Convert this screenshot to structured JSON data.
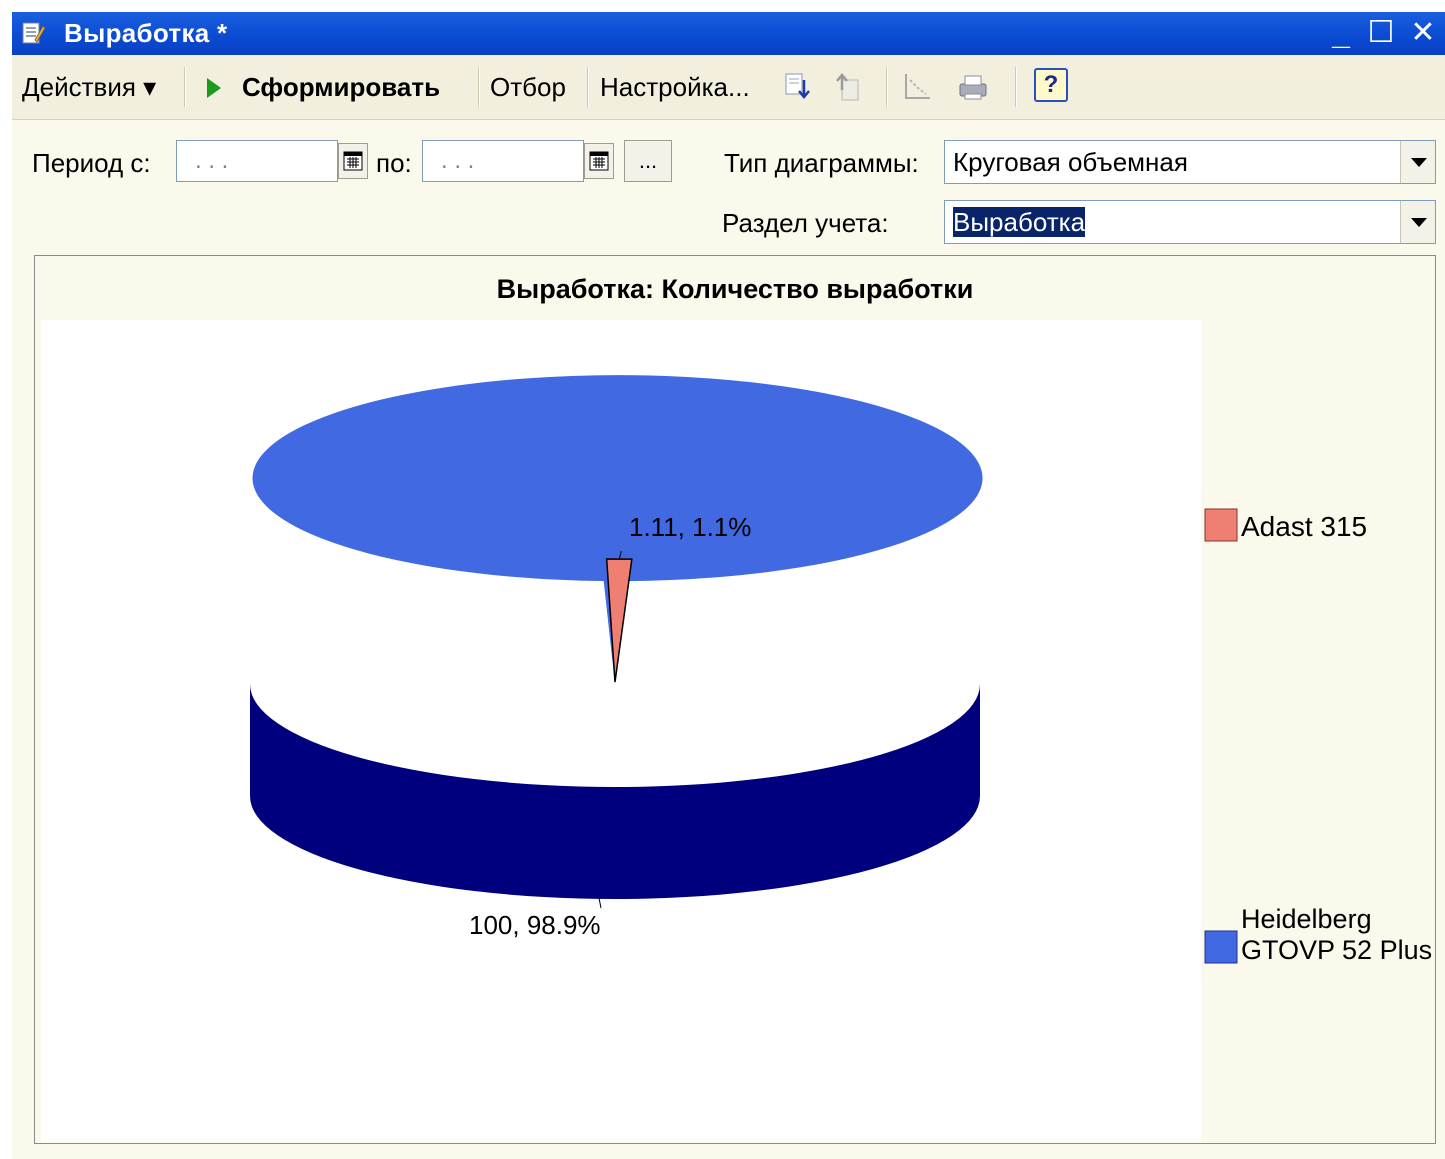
{
  "window": {
    "title": "Выработка *",
    "controls": [
      "_",
      "☐",
      "✕"
    ]
  },
  "toolbar": {
    "actions_label": "Действия ▾",
    "generate_label": "Сформировать",
    "filter_label": "Отбор",
    "settings_label": "Настройка...",
    "help_label": "?"
  },
  "form": {
    "period_from_label": "Период с:",
    "period_from_value": ". . .",
    "period_to_label": "по:",
    "period_to_value": ". . .",
    "ellipsis_label": "...",
    "chart_type_label": "Тип диаграммы:",
    "chart_type_value": "Круговая объемная",
    "section_label": "Раздел учета:",
    "section_value": "Выработка"
  },
  "colors": {
    "slice_adast": "#f07f73",
    "slice_heidelberg_top": "#4169e1",
    "slice_heidelberg_side": "#00007f"
  },
  "chart_data": {
    "type": "pie",
    "title": "Выработка: Количество выработки",
    "three_d": true,
    "legend_position": "right",
    "slices": [
      {
        "name": "Adast 315",
        "value": 1.11,
        "percent": 1.1,
        "label": "1.11, 1.1%",
        "color": "#f07f73"
      },
      {
        "name": "Heidelberg GTOVP 52 Plus",
        "value": 100,
        "percent": 98.9,
        "label": "100, 98.9%",
        "color": "#4169e1"
      }
    ]
  }
}
